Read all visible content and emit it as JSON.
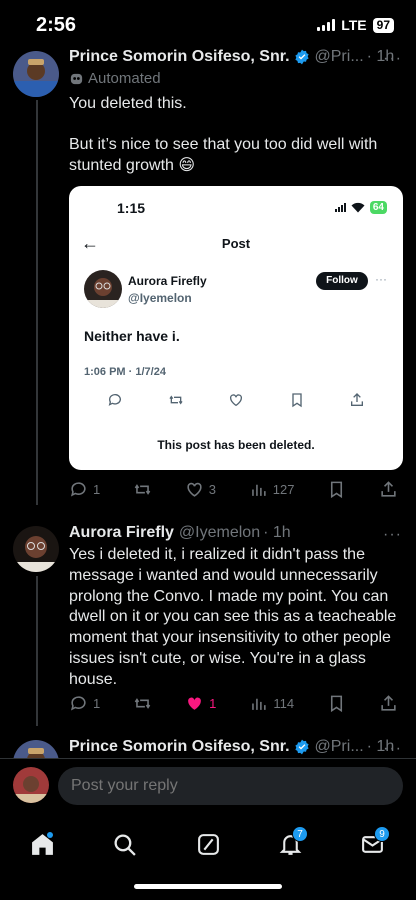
{
  "status_bar": {
    "time": "2:56",
    "network": "LTE",
    "battery": "97"
  },
  "tweet1": {
    "name": "Prince Somorin Osifeso, Snr.",
    "handle": "@Pri...",
    "time": "· 1h",
    "automated_label": "Automated",
    "line1": "You deleted this.",
    "line2": "But it’s nice to see that you too did well with stunted growth 😄",
    "embedded": {
      "time": "1:15",
      "battery": "64",
      "title": "Post",
      "name": "Aurora Firefly",
      "handle": "@Iyemelon",
      "follow_label": "Follow",
      "text": "Neither have i.",
      "date": "1:06 PM · 1/7/24",
      "deleted_note": "This post has been deleted."
    },
    "replies": "1",
    "likes": "3",
    "views": "127"
  },
  "tweet2": {
    "name": "Aurora Firefly",
    "handle": "@Iyemelon",
    "time": "· 1h",
    "text": "Yes i deleted it, i realized it didn't pass the message i wanted and would unnecessarily prolong the Convo. I made my point. You can dwell on it or you can see this as a teacheable moment that your insensitivity to other people issues isn't cute, or wise. You're in a glass house.",
    "replies": "1",
    "likes": "1",
    "views": "114"
  },
  "tweet3": {
    "name": "Prince Somorin Osifeso, Snr.",
    "handle": "@Pri...",
    "time": "· 1h"
  },
  "reply": {
    "placeholder": "Post your reply"
  },
  "nav": {
    "notifications_badge": "7",
    "messages_badge": "9"
  },
  "colors": {
    "accent": "#1d9bf0",
    "like_active": "#f91880",
    "muted": "#71767b"
  }
}
